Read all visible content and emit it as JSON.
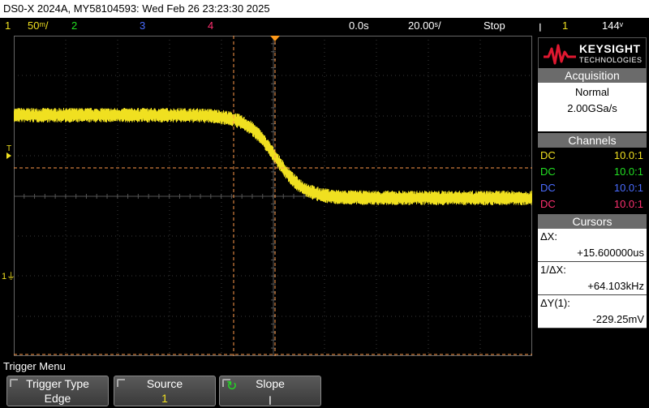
{
  "title": "DS0-X 2024A, MY58104593: Wed Feb 26 23:23:30 2025",
  "status": {
    "ch1_num": "1",
    "ch1_scale": "50ᵐ/",
    "ch2_num": "2",
    "ch3_num": "3",
    "ch4_num": "4",
    "time_offset": "0.0s",
    "time_scale": "20.00ˢ/",
    "run_state": "Stop",
    "trigger_symbol": "ꞁ",
    "trigger_source": "1",
    "trigger_level": "144ᵛ"
  },
  "colors": {
    "ch1": "#f0e020",
    "ch2": "#22e022",
    "ch3": "#4a6cff",
    "ch4": "#ff3070",
    "cursor": "#ff9a4a",
    "grid": "#3a3a3a"
  },
  "markers": {
    "trigger_level_label": "T",
    "ground_label": "1"
  },
  "logo": {
    "brand": "KEYSIGHT",
    "sub": "TECHNOLOGIES"
  },
  "acquisition": {
    "header": "Acquisition",
    "mode": "Normal",
    "rate": "2.00GSa/s"
  },
  "channels": {
    "header": "Channels",
    "rows": [
      {
        "coupling": "DC",
        "probe": "10.0:1"
      },
      {
        "coupling": "DC",
        "probe": "10.0:1"
      },
      {
        "coupling": "DC",
        "probe": "10.0:1"
      },
      {
        "coupling": "DC",
        "probe": "10.0:1"
      }
    ]
  },
  "cursors": {
    "header": "Cursors",
    "dx_label": "ΔX:",
    "dx_value": "+15.600000us",
    "inv_dx_label": "1/ΔX:",
    "inv_dx_value": "+64.103kHz",
    "dy_label": "ΔY(1):",
    "dy_value": "-229.25mV"
  },
  "menu": {
    "title": "Trigger Menu",
    "softkeys": [
      {
        "label": "Trigger Type",
        "value": "Edge"
      },
      {
        "label": "Source",
        "value": "1"
      },
      {
        "label": "Slope",
        "value": "ꞁ"
      }
    ]
  }
}
